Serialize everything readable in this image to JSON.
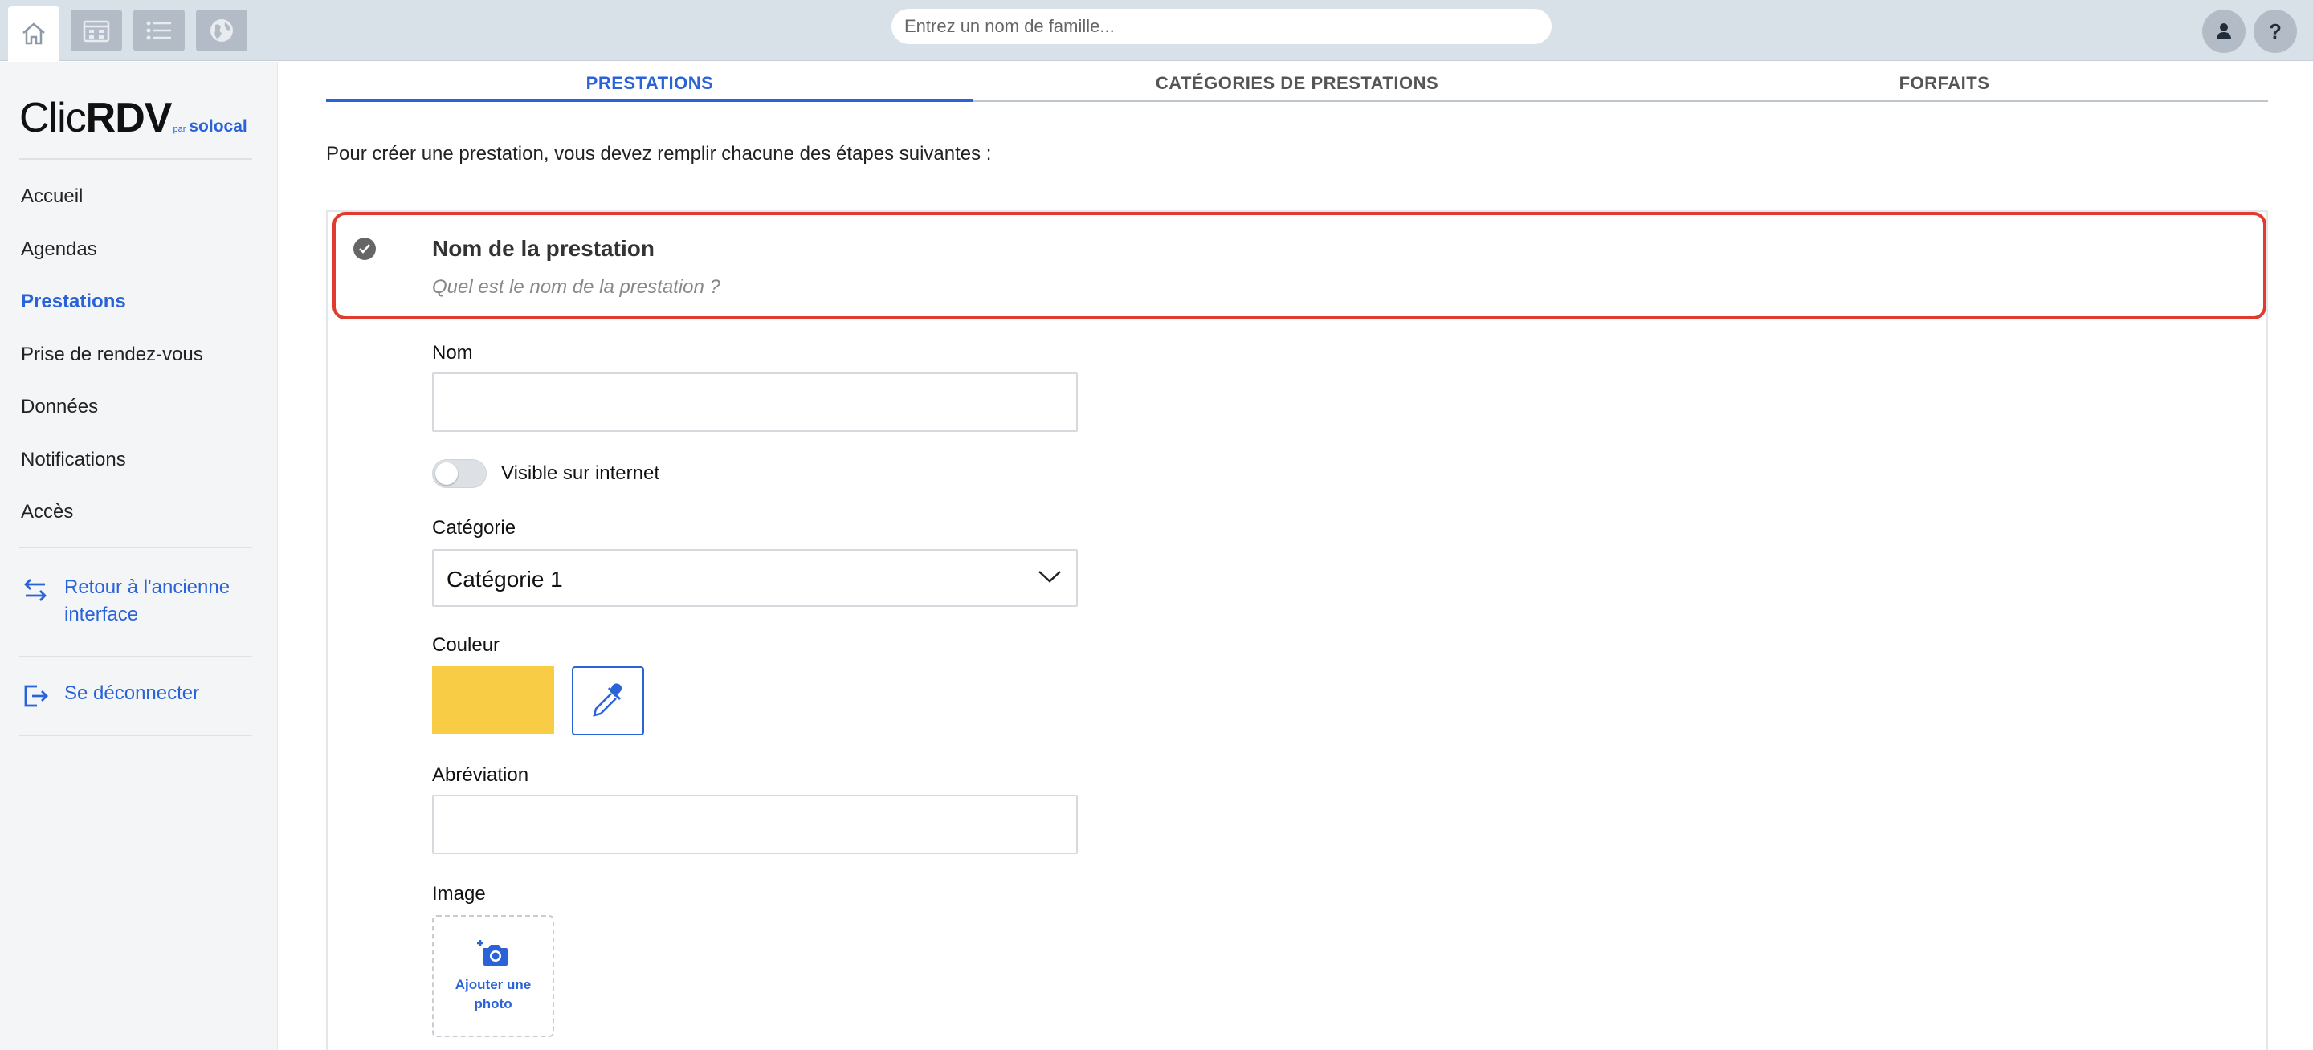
{
  "topbar": {
    "buttons": [
      "home-icon",
      "calendar-icon",
      "list-icon",
      "globe-icon"
    ],
    "search_placeholder": "Entrez un nom de famille...",
    "user_icon": "user-icon",
    "help_label": "?"
  },
  "sidebar": {
    "logo": {
      "clic": "Clic",
      "rdv": "RDV",
      "par": "par",
      "solocal": "solocal"
    },
    "items": [
      {
        "label": "Accueil"
      },
      {
        "label": "Agendas"
      },
      {
        "label": "Prestations",
        "active": true
      },
      {
        "label": "Prise de rendez-vous"
      },
      {
        "label": "Données"
      },
      {
        "label": "Notifications"
      },
      {
        "label": "Accès"
      }
    ],
    "old_interface_line1": "Retour à l'ancienne",
    "old_interface_line2": "interface",
    "logout": "Se déconnecter"
  },
  "tabs": [
    {
      "label": "PRESTATIONS",
      "active": true
    },
    {
      "label": "CATÉGORIES DE PRESTATIONS"
    },
    {
      "label": "FORFAITS"
    }
  ],
  "intro": "Pour créer une prestation, vous devez remplir chacune des étapes suivantes :",
  "step": {
    "title": "Nom de la prestation",
    "subtitle": "Quel est le nom de la prestation ?"
  },
  "form": {
    "nom_label": "Nom",
    "nom_value": "",
    "visible_label": "Visible sur internet",
    "visible_on": false,
    "categorie_label": "Catégorie",
    "categorie_value": "Catégorie 1",
    "couleur_label": "Couleur",
    "couleur_value": "#f8cc45",
    "abreviation_label": "Abréviation",
    "abreviation_value": "",
    "image_label": "Image",
    "add_photo_line1": "Ajouter une",
    "add_photo_line2": "photo"
  },
  "colors": {
    "accent": "#2a62d8",
    "highlight": "#e23b2e",
    "swatch": "#f8cc45"
  }
}
